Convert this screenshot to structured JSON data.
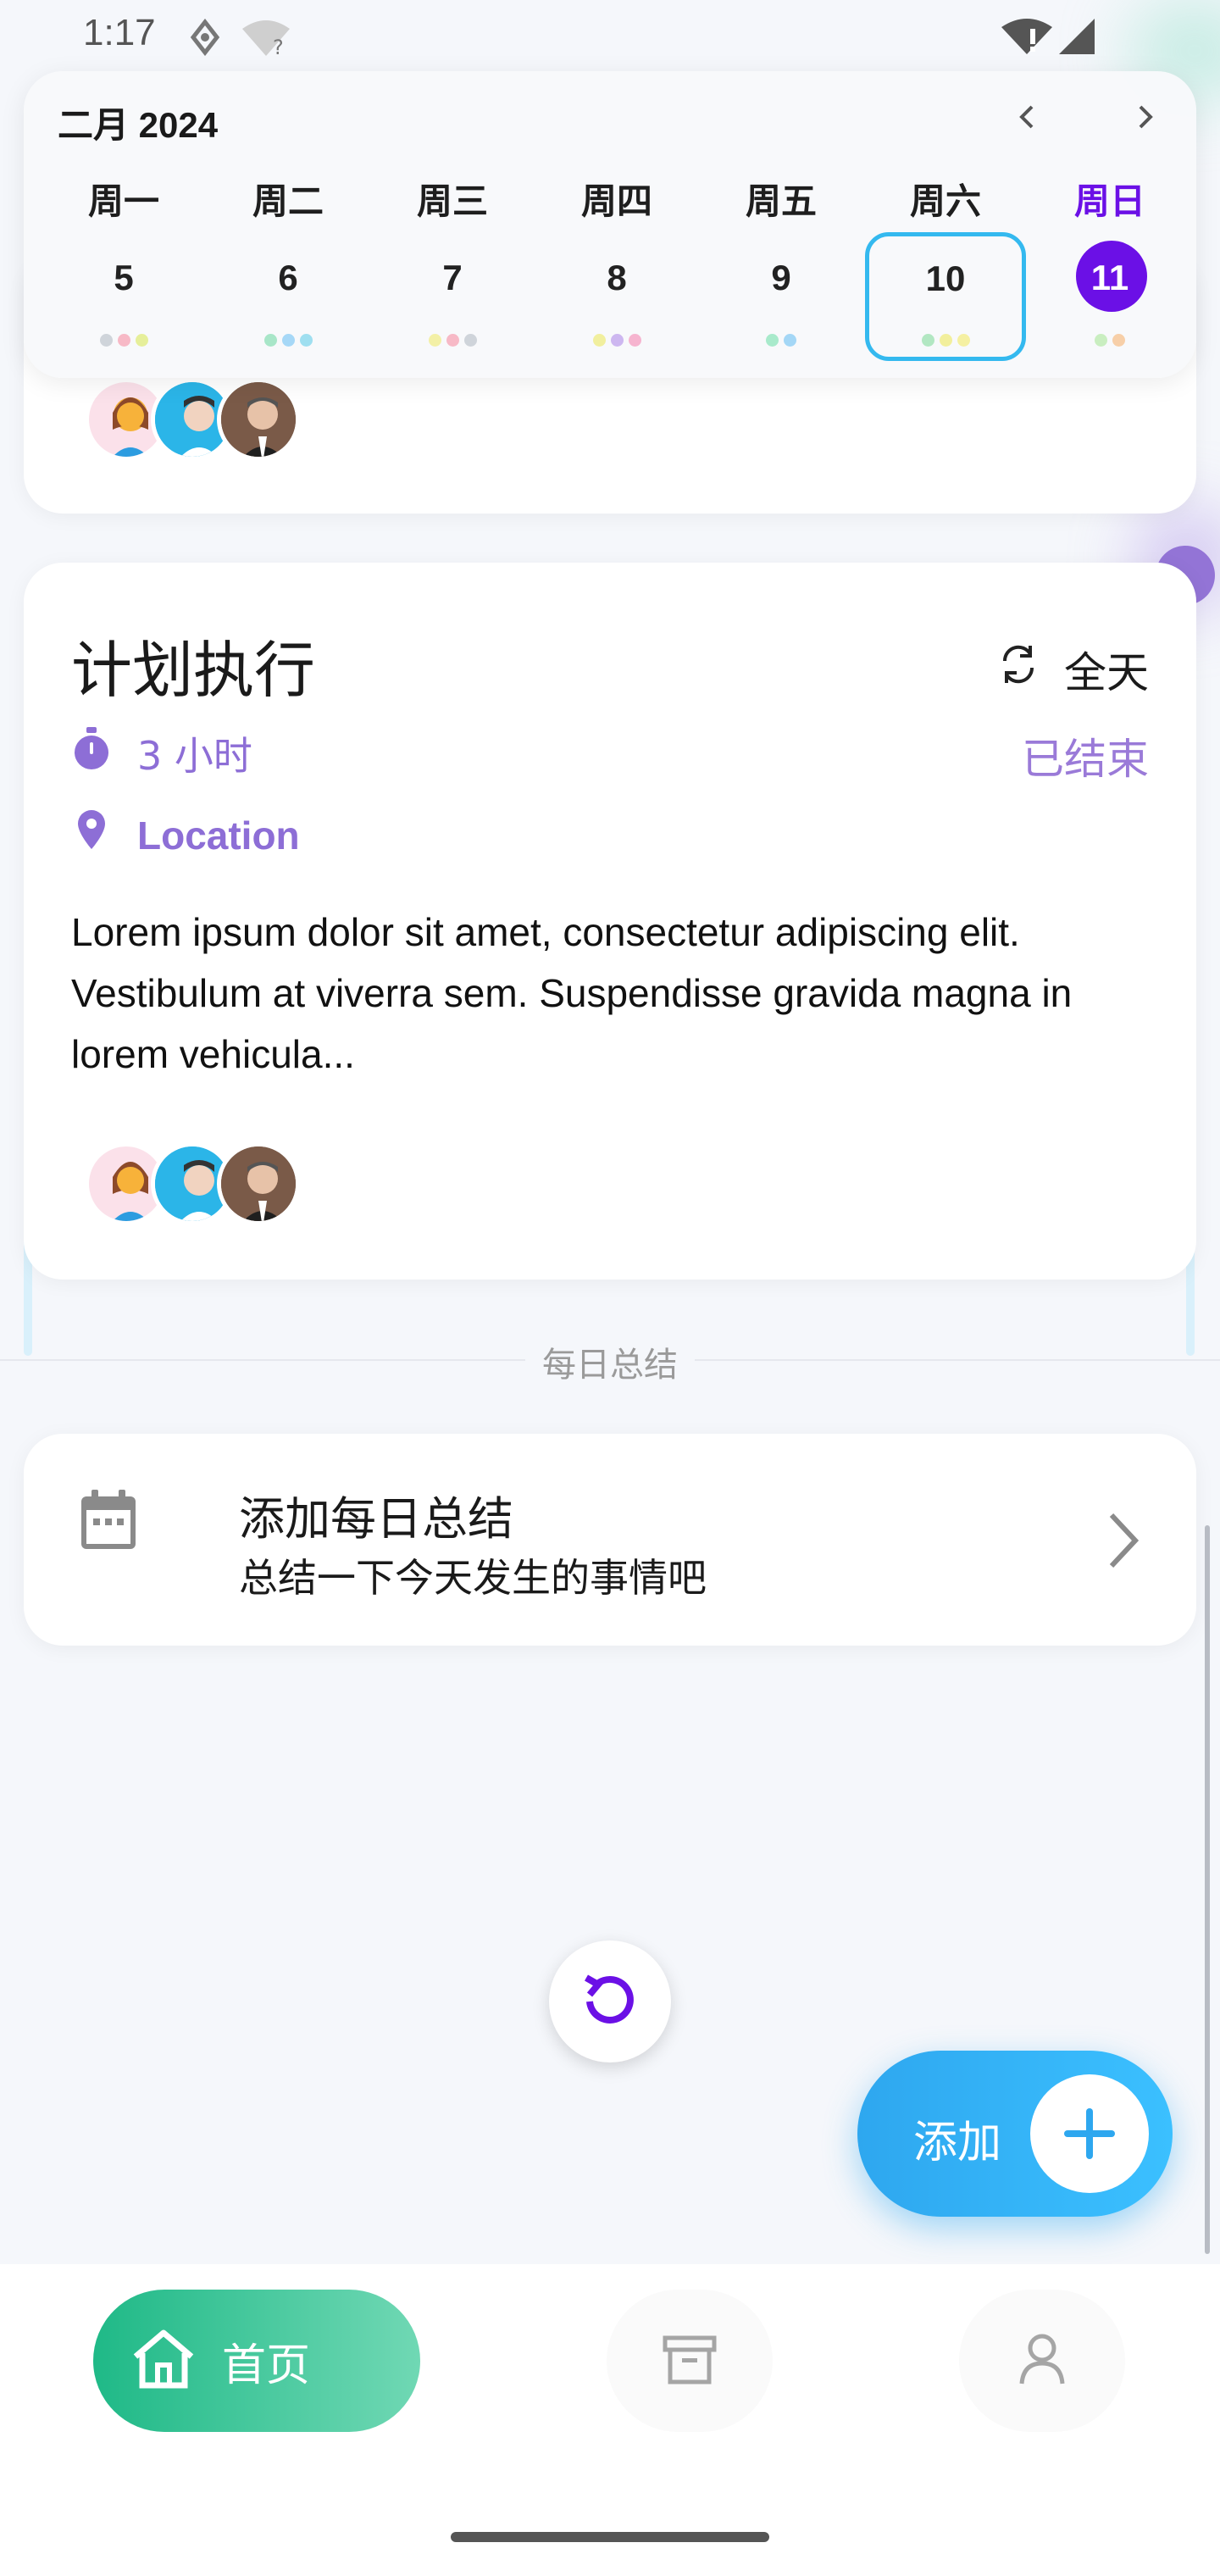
{
  "status_bar": {
    "time": "1:17"
  },
  "calendar": {
    "month_label": "二月 2024",
    "days": [
      {
        "weekday": "周一",
        "day": "5",
        "dots": [
          "#b7e4c0",
          "#f5c6d2",
          "#e6ef9a"
        ]
      },
      {
        "weekday": "周二",
        "day": "6",
        "dots": [
          "#a8e6c8",
          "#a6d8f7",
          "#9fdff0"
        ]
      },
      {
        "weekday": "周三",
        "day": "7",
        "dots": [
          "#f3f0a6",
          "#f7b9c6",
          "#cfd4da"
        ]
      },
      {
        "weekday": "周四",
        "day": "8",
        "dots": [
          "#f1ef9e",
          "#cdb7f0",
          "#f6b4cf"
        ]
      },
      {
        "weekday": "周五",
        "day": "9",
        "dots": [
          "#a8eacb",
          "#a4d7f6"
        ]
      },
      {
        "weekday": "周六",
        "day": "10",
        "dots": [
          "#b2e7c2",
          "#f2ef9c",
          "#f5f0a2"
        ]
      },
      {
        "weekday": "周日",
        "day": "11",
        "dots": [
          "#c9eec0",
          "#f7cfa8"
        ]
      }
    ],
    "selected_day": "10",
    "today": "11",
    "accent": "#6b10e6",
    "selection_color": "#34b9ef"
  },
  "event": {
    "title": "计划执行",
    "all_day_label": "全天",
    "duration": "3 小时",
    "status": "已结束",
    "location": "Location",
    "description": "Lorem ipsum dolor sit amet, consectetur adipiscing elit. Vestibulum at viverra sem. Suspendisse gravida magna in lorem vehicula..."
  },
  "daily_summary": {
    "section_label": "每日总结",
    "title": "添加每日总结",
    "subtitle": "总结一下今天发生的事情吧"
  },
  "fab": {
    "label": "添加"
  },
  "bottom_nav": {
    "home_label": "首页"
  },
  "colors": {
    "meta": "#8d6ed6",
    "fab": "#2ea7ef",
    "home_nav": "#1fb987"
  }
}
